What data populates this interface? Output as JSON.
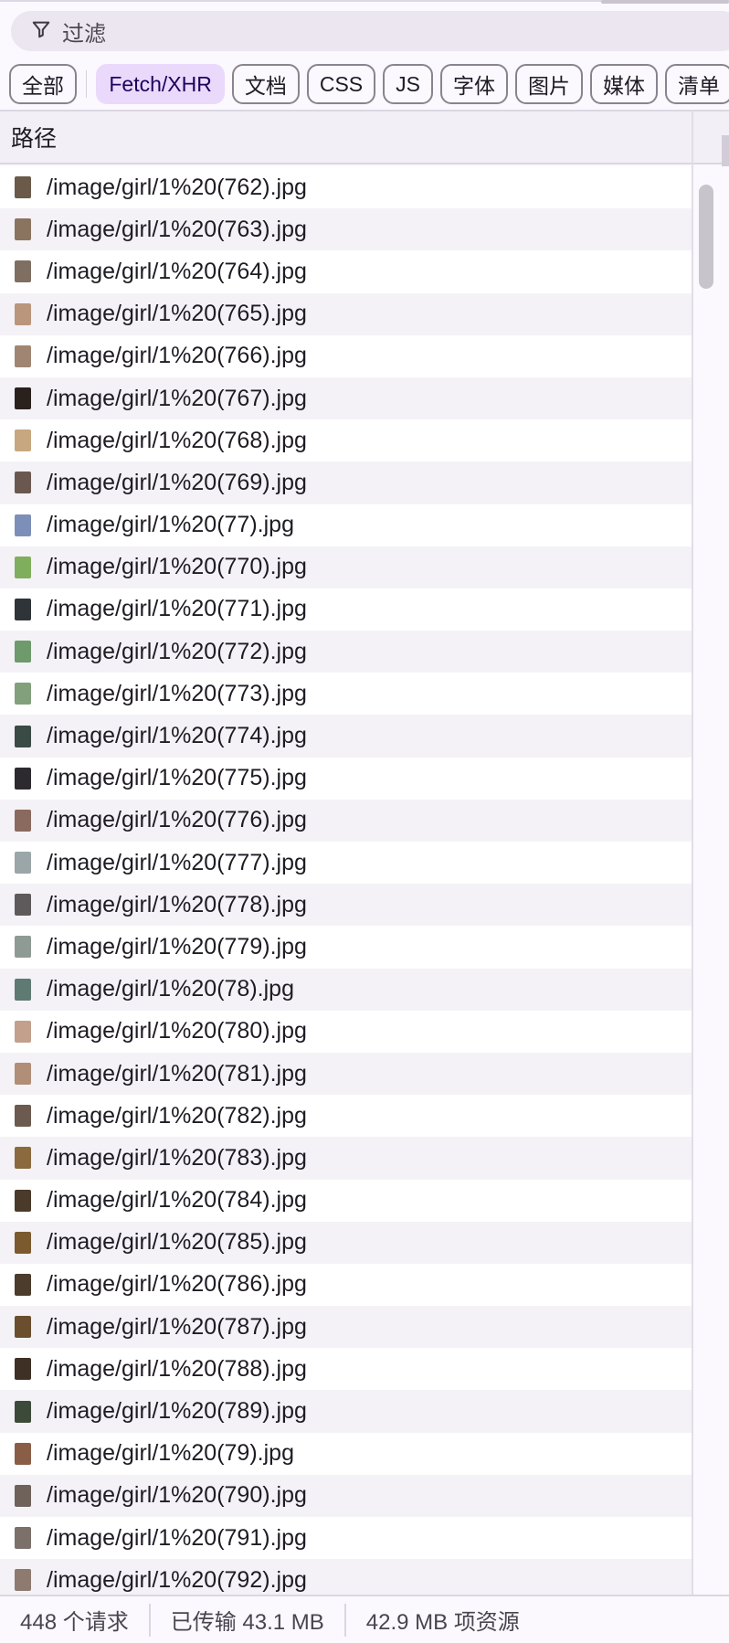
{
  "filter": {
    "placeholder": "过滤",
    "icon": "filter-icon"
  },
  "chips": [
    {
      "label": "全部",
      "active": false
    },
    {
      "label": "Fetch/XHR",
      "active": true
    },
    {
      "label": "文档",
      "active": false
    },
    {
      "label": "CSS",
      "active": false
    },
    {
      "label": "JS",
      "active": false
    },
    {
      "label": "字体",
      "active": false
    },
    {
      "label": "图片",
      "active": false
    },
    {
      "label": "媒体",
      "active": false
    },
    {
      "label": "清单",
      "active": false
    }
  ],
  "table": {
    "header": "路径",
    "rows": [
      {
        "path": "/image/girl/1%20(762).jpg",
        "thumb": "#6b5a4a"
      },
      {
        "path": "/image/girl/1%20(763).jpg",
        "thumb": "#8a7460"
      },
      {
        "path": "/image/girl/1%20(764).jpg",
        "thumb": "#7f6f62"
      },
      {
        "path": "/image/girl/1%20(765).jpg",
        "thumb": "#b9967c"
      },
      {
        "path": "/image/girl/1%20(766).jpg",
        "thumb": "#a08672"
      },
      {
        "path": "/image/girl/1%20(767).jpg",
        "thumb": "#2a211d"
      },
      {
        "path": "/image/girl/1%20(768).jpg",
        "thumb": "#c7a77f"
      },
      {
        "path": "/image/girl/1%20(769).jpg",
        "thumb": "#6a5850"
      },
      {
        "path": "/image/girl/1%20(77).jpg",
        "thumb": "#7d8fb8"
      },
      {
        "path": "/image/girl/1%20(770).jpg",
        "thumb": "#7fae5c"
      },
      {
        "path": "/image/girl/1%20(771).jpg",
        "thumb": "#2f3438"
      },
      {
        "path": "/image/girl/1%20(772).jpg",
        "thumb": "#6e9a6c"
      },
      {
        "path": "/image/girl/1%20(773).jpg",
        "thumb": "#82a07c"
      },
      {
        "path": "/image/girl/1%20(774).jpg",
        "thumb": "#3a4a44"
      },
      {
        "path": "/image/girl/1%20(775).jpg",
        "thumb": "#2c2a2e"
      },
      {
        "path": "/image/girl/1%20(776).jpg",
        "thumb": "#8a6a5e"
      },
      {
        "path": "/image/girl/1%20(777).jpg",
        "thumb": "#9aa6a8"
      },
      {
        "path": "/image/girl/1%20(778).jpg",
        "thumb": "#5e5a5c"
      },
      {
        "path": "/image/girl/1%20(779).jpg",
        "thumb": "#8e9a94"
      },
      {
        "path": "/image/girl/1%20(78).jpg",
        "thumb": "#5e7a72"
      },
      {
        "path": "/image/girl/1%20(780).jpg",
        "thumb": "#c2a08c"
      },
      {
        "path": "/image/girl/1%20(781).jpg",
        "thumb": "#b08e78"
      },
      {
        "path": "/image/girl/1%20(782).jpg",
        "thumb": "#6c5a50"
      },
      {
        "path": "/image/girl/1%20(783).jpg",
        "thumb": "#8a6a3e"
      },
      {
        "path": "/image/girl/1%20(784).jpg",
        "thumb": "#4a3a2a"
      },
      {
        "path": "/image/girl/1%20(785).jpg",
        "thumb": "#7a5a2e"
      },
      {
        "path": "/image/girl/1%20(786).jpg",
        "thumb": "#4c3c2c"
      },
      {
        "path": "/image/girl/1%20(787).jpg",
        "thumb": "#6a4e2e"
      },
      {
        "path": "/image/girl/1%20(788).jpg",
        "thumb": "#3e3024"
      },
      {
        "path": "/image/girl/1%20(789).jpg",
        "thumb": "#3c4a3a"
      },
      {
        "path": "/image/girl/1%20(79).jpg",
        "thumb": "#8a5e46"
      },
      {
        "path": "/image/girl/1%20(790).jpg",
        "thumb": "#6e625a"
      },
      {
        "path": "/image/girl/1%20(791).jpg",
        "thumb": "#7c706a"
      },
      {
        "path": "/image/girl/1%20(792).jpg",
        "thumb": "#8e7a6e"
      }
    ]
  },
  "status": {
    "requests": "448 个请求",
    "transferred": "已传输 43.1 MB",
    "resources": "42.9 MB 项资源"
  }
}
